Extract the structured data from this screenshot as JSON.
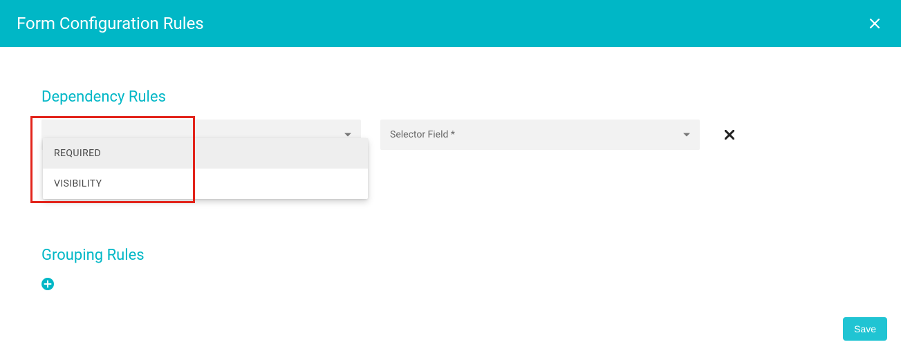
{
  "header": {
    "title": "Form Configuration Rules"
  },
  "sections": {
    "dependency": {
      "title": "Dependency Rules"
    },
    "grouping": {
      "title": "Grouping Rules"
    }
  },
  "ruleTypeDropdown": {
    "options": [
      "REQUIRED",
      "VISIBILITY"
    ]
  },
  "selectorField": {
    "placeholder": "Selector Field *"
  },
  "buttons": {
    "save": "Save"
  }
}
